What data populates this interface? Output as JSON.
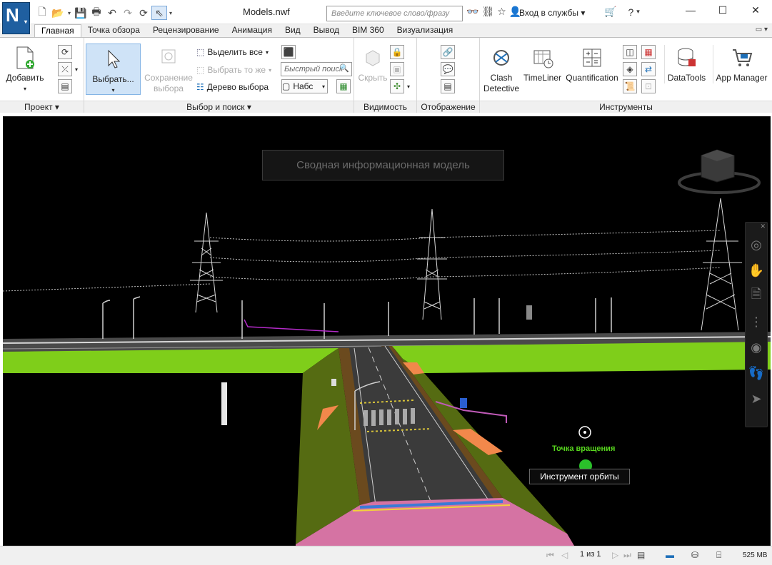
{
  "app": {
    "logo_letter": "N",
    "document_title": "Models.nwf",
    "search_placeholder": "Введите ключевое слово/фразу",
    "signin_label": "Вход в службы"
  },
  "ribbon": {
    "tabs": [
      "Главная",
      "Точка обзора",
      "Рецензирование",
      "Анимация",
      "Вид",
      "Вывод",
      "BIM 360",
      "Визуализация"
    ],
    "active_tab": "Главная",
    "project_panel": {
      "title": "Проект",
      "add_label": "Добавить"
    },
    "select_panel": {
      "title": "Выбор и поиск",
      "select_label": "Выбрать...",
      "save_selection_label": "Сохранение\nвыбора",
      "select_all_label": "Выделить все",
      "select_same_label": "Выбрать то же",
      "selection_tree_label": "Дерево выбора",
      "quick_find_placeholder": "Быстрый поиск",
      "sets_label": "Набс"
    },
    "visibility_panel": {
      "title": "Видимость",
      "hide_label": "Скрыть"
    },
    "display_panel": {
      "title": "Отображение"
    },
    "tools_panel": {
      "title": "Инструменты",
      "clash_label": "Clash\nDetective",
      "timeliner_label": "TimeLiner",
      "quantification_label": "Quantification",
      "datatools_label": "DataTools",
      "appmanager_label": "App Manager"
    }
  },
  "viewport": {
    "model_banner": "Сводная информационная модель",
    "orbit_point_label": "Точка вращения",
    "orbit_tooltip": "Инструмент орбиты"
  },
  "statusbar": {
    "page_indicator": "1 из 1",
    "memory": "525 MB"
  },
  "colors": {
    "logo_blue": "#1f5fa0",
    "grass": "#7fce1a",
    "road": "#3b3b3b",
    "embankment": "#5a4a1f",
    "orbit_green": "#58d81e"
  }
}
